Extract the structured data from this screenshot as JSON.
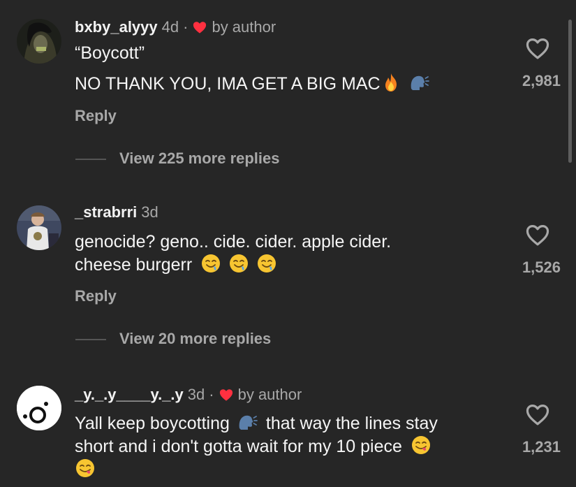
{
  "comments": [
    {
      "username": "bxby_alyyy",
      "time": "4d",
      "separator": "·",
      "author_liked": true,
      "author_label": "by author",
      "lines": [
        "“Boycott”",
        "NO THANK YOU, IMA GET A BIG MAC"
      ],
      "emoji": [
        "fire-emoji",
        "speaking-head-emoji"
      ],
      "reply_label": "Reply",
      "view_replies": "View 225 more replies",
      "likes": "2,981"
    },
    {
      "username": "_strabrri",
      "time": "3d",
      "author_liked": false,
      "lines": [
        "genocide? geno.. cide. cider. apple cider.",
        "cheese burgerr"
      ],
      "emoji": [
        "drooling-face-emoji",
        "drooling-face-emoji",
        "drooling-face-emoji"
      ],
      "reply_label": "Reply",
      "view_replies": "View 20 more replies",
      "likes": "1,526"
    },
    {
      "username": "_y._.y____y._.y",
      "time": "3d",
      "separator": "·",
      "author_liked": true,
      "author_label": "by author",
      "lines": [
        "Yall keep boycotting",
        "that way the lines stay",
        "short and i don't gotta wait for my 10 piece"
      ],
      "emoji": [
        "speaking-head-emoji",
        "yum-face-emoji",
        "yum-face-emoji"
      ],
      "likes": "1,231"
    }
  ],
  "colors": {
    "background": "#262626",
    "text": "#f5f5f5",
    "muted": "#a8a8a8",
    "heart_red": "#ff3040"
  }
}
